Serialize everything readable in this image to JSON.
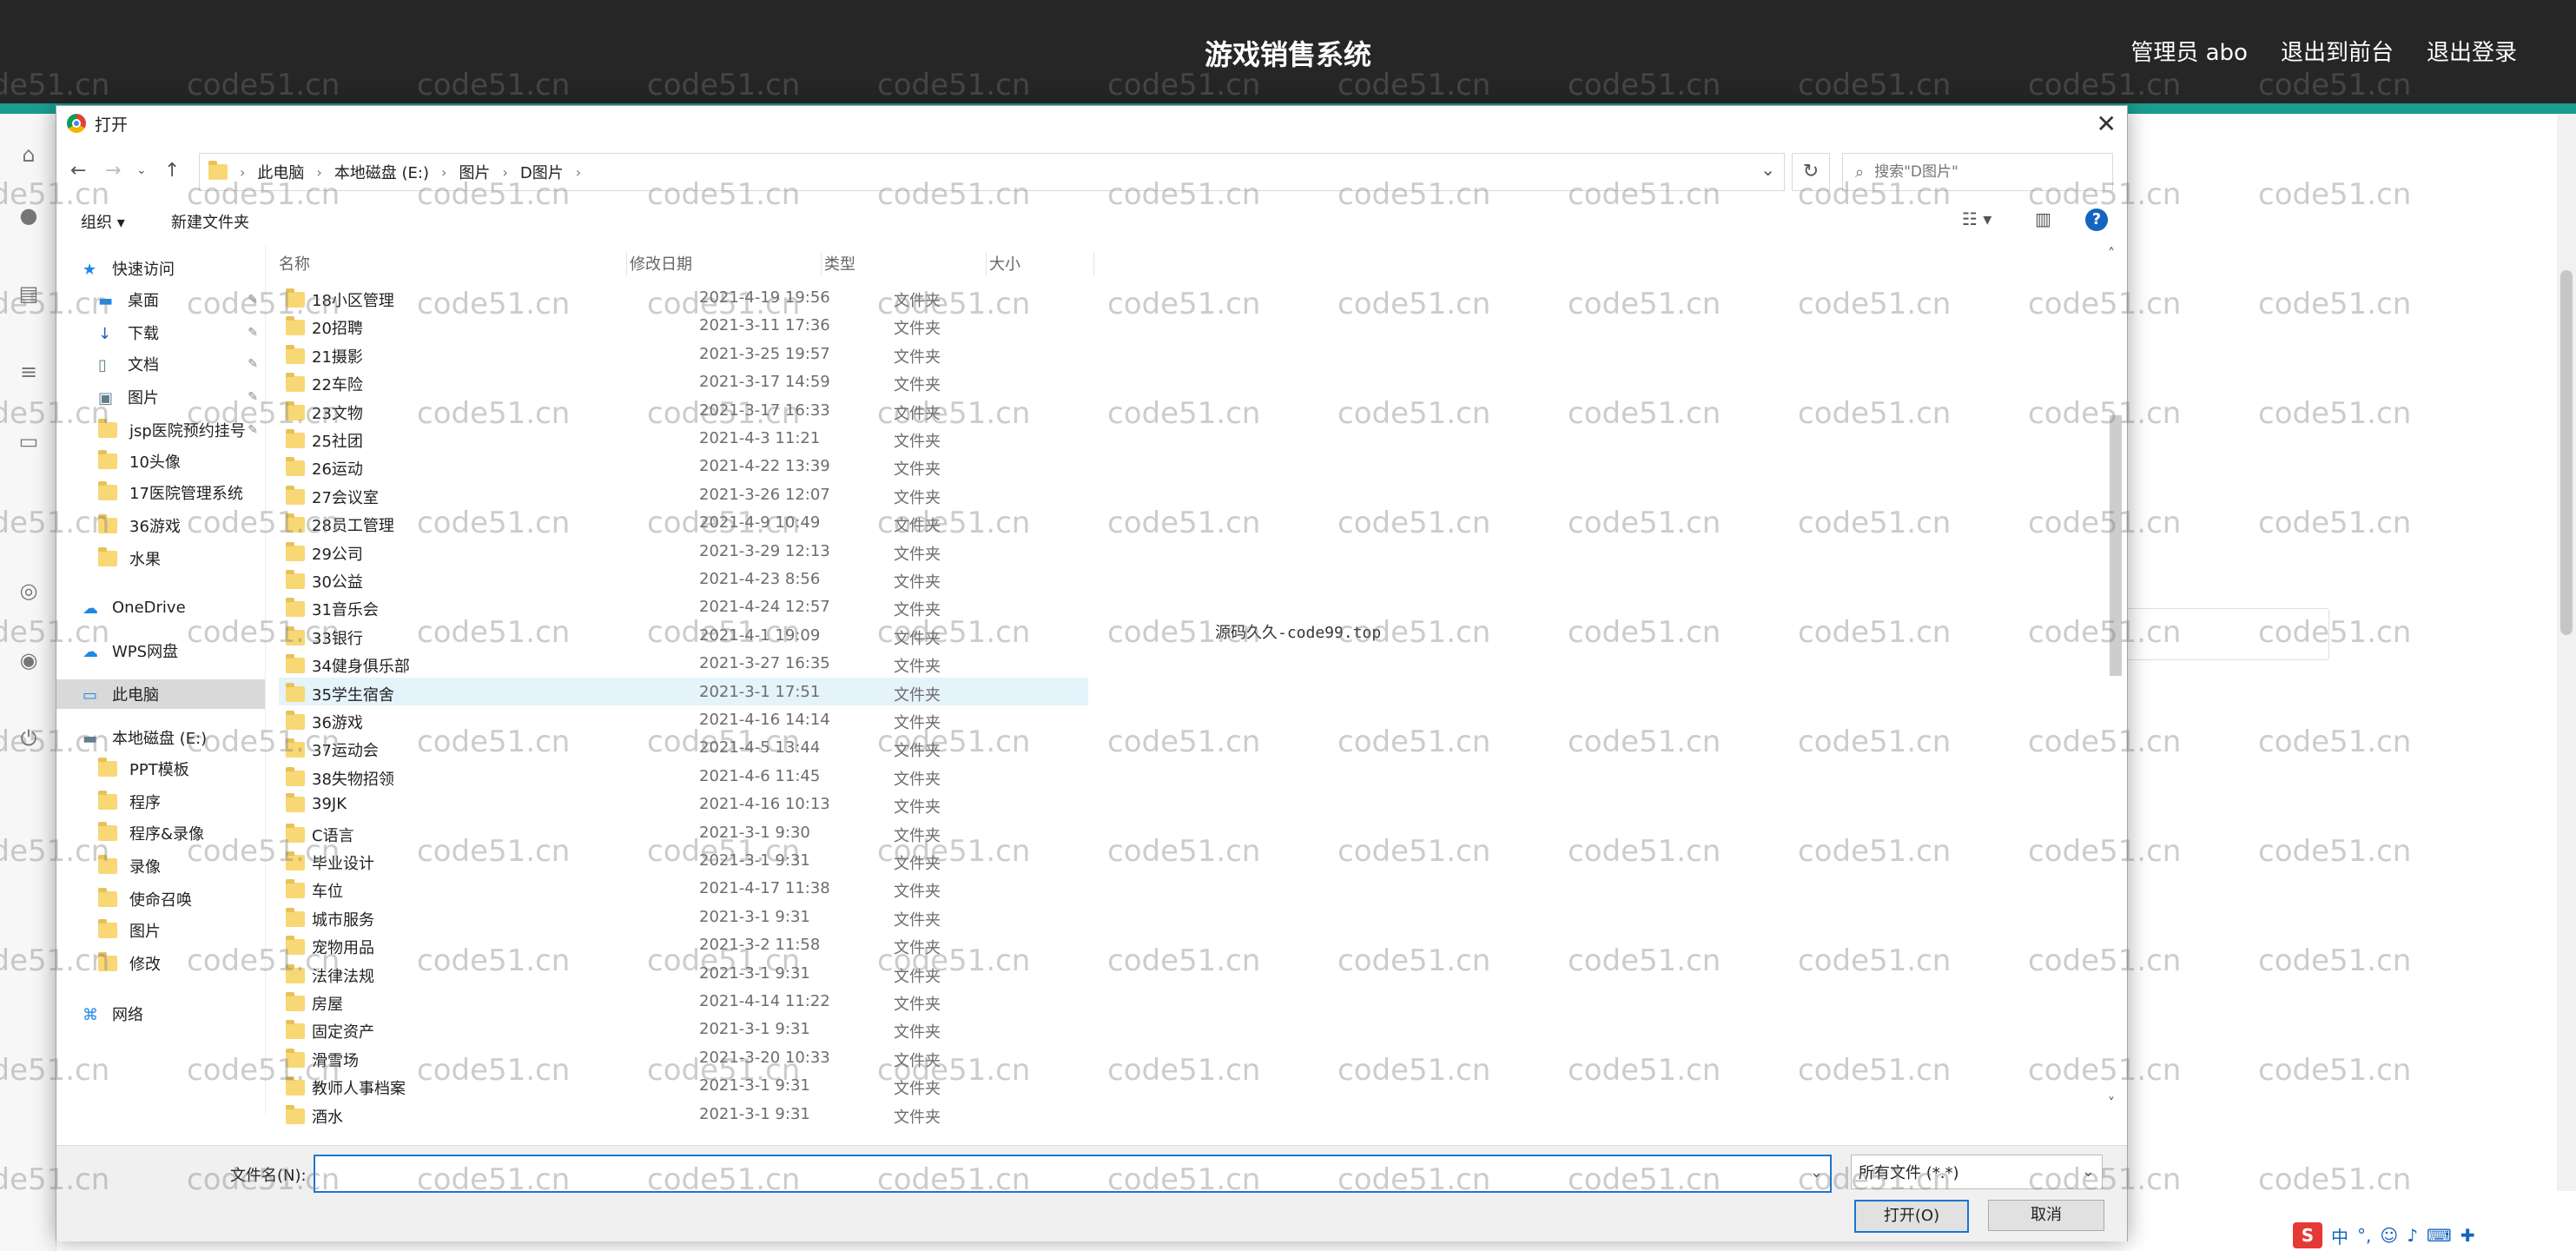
{
  "header": {
    "title": "游戏销售系统",
    "links": [
      "管理员 abo",
      "退出到前台",
      "退出登录"
    ]
  },
  "dialog": {
    "title": "打开",
    "breadcrumb": [
      "此电脑",
      "本地磁盘 (E:)",
      "图片",
      "D图片"
    ],
    "search_placeholder": "搜索\"D图片\"",
    "toolbar": {
      "organize": "组织 ▾",
      "new_folder": "新建文件夹"
    },
    "columns": {
      "name": "名称",
      "date": "修改日期",
      "type": "类型",
      "size": "大小"
    },
    "nav": [
      {
        "label": "快速访问",
        "icon": "star-icon"
      },
      {
        "label": "桌面",
        "icon": "desktop-icon",
        "pinned": true
      },
      {
        "label": "下载",
        "icon": "download-icon",
        "pinned": true
      },
      {
        "label": "文档",
        "icon": "document-icon",
        "pinned": true
      },
      {
        "label": "图片",
        "icon": "picture-icon",
        "pinned": true
      },
      {
        "label": "jsp医院预约挂号",
        "icon": "folder-icon",
        "pinned": true
      },
      {
        "label": "10头像",
        "icon": "folder-icon"
      },
      {
        "label": "17医院管理系统",
        "icon": "folder-icon"
      },
      {
        "label": "36游戏",
        "icon": "folder-icon"
      },
      {
        "label": "水果",
        "icon": "folder-icon"
      },
      {
        "label": "OneDrive",
        "icon": "cloud-icon"
      },
      {
        "label": "WPS网盘",
        "icon": "cloud-icon"
      },
      {
        "label": "此电脑",
        "icon": "computer-icon",
        "selected": true
      },
      {
        "label": "本地磁盘 (E:)",
        "icon": "drive-icon"
      },
      {
        "label": "PPT模板",
        "icon": "folder-icon"
      },
      {
        "label": "程序",
        "icon": "folder-icon"
      },
      {
        "label": "程序&录像",
        "icon": "folder-icon"
      },
      {
        "label": "录像",
        "icon": "folder-icon"
      },
      {
        "label": "使命召唤",
        "icon": "folder-icon"
      },
      {
        "label": "图片",
        "icon": "folder-icon"
      },
      {
        "label": "修改",
        "icon": "folder-icon"
      },
      {
        "label": "网络",
        "icon": "network-icon"
      }
    ],
    "files": [
      {
        "name": "18小区管理",
        "date": "2021-4-19 19:56",
        "type": "文件夹"
      },
      {
        "name": "20招聘",
        "date": "2021-3-11 17:36",
        "type": "文件夹"
      },
      {
        "name": "21摄影",
        "date": "2021-3-25 19:57",
        "type": "文件夹"
      },
      {
        "name": "22车险",
        "date": "2021-3-17 14:59",
        "type": "文件夹"
      },
      {
        "name": "23文物",
        "date": "2021-3-17 16:33",
        "type": "文件夹"
      },
      {
        "name": "25社团",
        "date": "2021-4-3 11:21",
        "type": "文件夹"
      },
      {
        "name": "26运动",
        "date": "2021-4-22 13:39",
        "type": "文件夹"
      },
      {
        "name": "27会议室",
        "date": "2021-3-26 12:07",
        "type": "文件夹"
      },
      {
        "name": "28员工管理",
        "date": "2021-4-9 10:49",
        "type": "文件夹"
      },
      {
        "name": "29公司",
        "date": "2021-3-29 12:13",
        "type": "文件夹"
      },
      {
        "name": "30公益",
        "date": "2021-4-23 8:56",
        "type": "文件夹"
      },
      {
        "name": "31音乐会",
        "date": "2021-4-24 12:57",
        "type": "文件夹"
      },
      {
        "name": "33银行",
        "date": "2021-4-1 19:09",
        "type": "文件夹"
      },
      {
        "name": "34健身俱乐部",
        "date": "2021-3-27 16:35",
        "type": "文件夹"
      },
      {
        "name": "35学生宿舍",
        "date": "2021-3-1 17:51",
        "type": "文件夹",
        "hover": true
      },
      {
        "name": "36游戏",
        "date": "2021-4-16 14:14",
        "type": "文件夹"
      },
      {
        "name": "37运动会",
        "date": "2021-4-5 13:44",
        "type": "文件夹"
      },
      {
        "name": "38失物招领",
        "date": "2021-4-6 11:45",
        "type": "文件夹"
      },
      {
        "name": "39JK",
        "date": "2021-4-16 10:13",
        "type": "文件夹"
      },
      {
        "name": "C语言",
        "date": "2021-3-1 9:30",
        "type": "文件夹"
      },
      {
        "name": "毕业设计",
        "date": "2021-3-1 9:31",
        "type": "文件夹"
      },
      {
        "name": "车位",
        "date": "2021-4-17 11:38",
        "type": "文件夹"
      },
      {
        "name": "城市服务",
        "date": "2021-3-1 9:31",
        "type": "文件夹"
      },
      {
        "name": "宠物用品",
        "date": "2021-3-2 11:58",
        "type": "文件夹"
      },
      {
        "name": "法律法规",
        "date": "2021-3-1 9:31",
        "type": "文件夹"
      },
      {
        "name": "房屋",
        "date": "2021-4-14 11:22",
        "type": "文件夹"
      },
      {
        "name": "固定资产",
        "date": "2021-3-1 9:31",
        "type": "文件夹"
      },
      {
        "name": "滑雪场",
        "date": "2021-3-20 10:33",
        "type": "文件夹"
      },
      {
        "name": "教师人事档案",
        "date": "2021-3-1 9:31",
        "type": "文件夹"
      },
      {
        "name": "酒水",
        "date": "2021-3-1 9:31",
        "type": "文件夹"
      }
    ],
    "overlay_text": "源码久久-code99.top",
    "filename_label": "文件名(N):",
    "filename_value": "",
    "filter_value": "所有文件 (*.*)",
    "open_button": "打开(O)",
    "cancel_button": "取消"
  },
  "watermark": "code51.cn",
  "ime": {
    "label": "中"
  },
  "colors": {
    "topbar": "#262626",
    "accent": "#1a9d8f",
    "focus": "#1976d2"
  }
}
